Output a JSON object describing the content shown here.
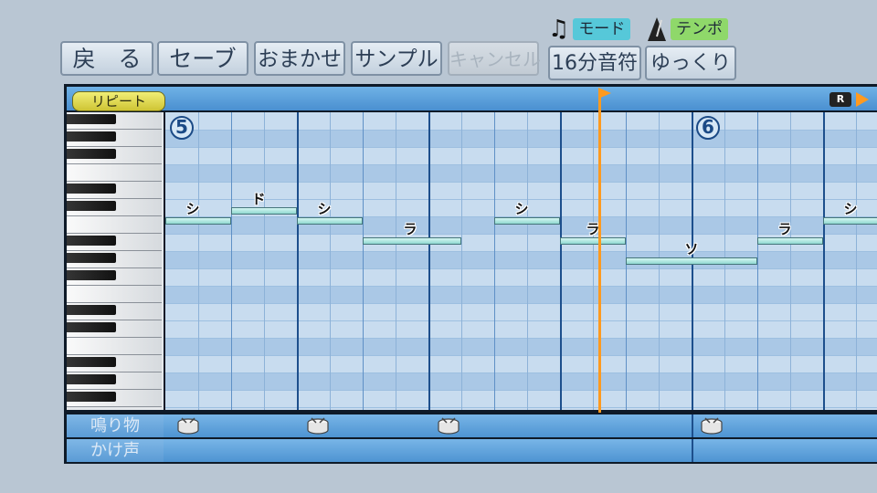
{
  "toolbar": {
    "back": "戻　る",
    "save": "セーブ",
    "auto": "おまかせ",
    "sample": "サンプル",
    "cancel": "キャンセル",
    "mode_value": "16分音符",
    "tempo_value": "ゆっくり"
  },
  "labels": {
    "mode": "モード",
    "tempo": "テンポ"
  },
  "header": {
    "repeat": "リピート",
    "record_badge": "R"
  },
  "measures": [
    "5",
    "6"
  ],
  "notes": [
    {
      "label": "シ"
    },
    {
      "label": "ド"
    },
    {
      "label": "シ"
    },
    {
      "label": "ラ"
    },
    {
      "label": "シ"
    },
    {
      "label": "ラ"
    },
    {
      "label": "ソ"
    },
    {
      "label": "ラ"
    },
    {
      "label": "シ"
    }
  ],
  "tracks": {
    "percussion": "鳴り物",
    "shout": "かけ声"
  },
  "colors": {
    "playhead": "#ff9a1f",
    "note": "#a8e6e0",
    "mode_tag": "#56c8d9",
    "tempo_tag": "#8fd86a",
    "repeat": "#e4de52"
  }
}
